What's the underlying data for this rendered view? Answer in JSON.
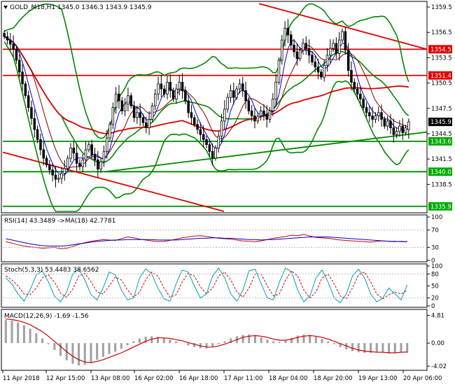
{
  "window": {
    "symbol_line": "GOLD_M18,H1  1345.0 1346.3 1343.9 1345.9",
    "rsi_title": "RSI(14) 43.3489  ->MA(18) 42.7781",
    "stoch_title": "Stoch(5,3,3) 53.4483 38.6562",
    "macd_title": "MACD(12,26,9) -1.69 -1.56"
  },
  "colors": {
    "resistance_line": "#dd0000",
    "support_line": "#008800",
    "bollinger": "#008800",
    "ma_slow": "#dd0000",
    "ma_fast": "#0000cc",
    "ma_mid": "#800000",
    "rsi_line": "#cc0000",
    "rsi_ma": "#0000cc",
    "stoch_main": "#00a0b0",
    "stoch_signal": "#cc0000",
    "macd_hist": "#a0a0a0",
    "macd_signal": "#cc0000",
    "tag_red": "#e00000",
    "tag_green": "#00aa00",
    "tag_black": "#000000"
  },
  "chart_data": [
    {
      "type": "candlestick",
      "panel": "main",
      "title": "GOLD_M18,H1",
      "ohlc_last": {
        "open": 1345.0,
        "high": 1346.3,
        "low": 1343.9,
        "close": 1345.9
      },
      "ylim": [
        1335.3,
        1360.0
      ],
      "y_ticks": [
        "1359.5",
        "1356.5",
        "1353.5",
        "1350.5",
        "1347.5",
        "1344.5",
        "1341.5",
        "1338.5"
      ],
      "price_tags": [
        {
          "label": "1354.5",
          "value": 1354.5,
          "color": "red"
        },
        {
          "label": "1351.4",
          "value": 1351.4,
          "color": "red"
        },
        {
          "label": "1345.9",
          "value": 1345.9,
          "color": "black"
        },
        {
          "label": "1343.6",
          "value": 1343.6,
          "color": "green"
        },
        {
          "label": "1340.0",
          "value": 1340.0,
          "color": "green"
        },
        {
          "label": "1335.9",
          "value": 1335.9,
          "color": "green"
        }
      ],
      "x_labels": [
        "11 Apr 2018",
        "12 Apr 15:00",
        "13 Apr 08:00",
        "16 Apr 02:00",
        "16 Apr 18:00",
        "17 Apr 11:00",
        "18 Apr 04:00",
        "18 Apr 20:00",
        "19 Apr 13:00",
        "20 Apr 06:00"
      ],
      "closes": [
        1356.0,
        1355.6,
        1355.1,
        1354.5,
        1353.2,
        1351.8,
        1350.4,
        1349.0,
        1347.6,
        1346.3,
        1345.0,
        1343.8,
        1342.6,
        1341.6,
        1340.8,
        1340.2,
        1339.6,
        1339.1,
        1339.2,
        1339.8,
        1340.4,
        1341.6,
        1342.8,
        1342.2,
        1341.0,
        1340.6,
        1341.4,
        1342.6,
        1343.2,
        1342.0,
        1341.4,
        1340.3,
        1341.2,
        1342.4,
        1344.0,
        1345.6,
        1347.6,
        1349.2,
        1348.4,
        1347.2,
        1348.0,
        1349.0,
        1347.8,
        1346.4,
        1347.0,
        1346.4,
        1345.8,
        1345.2,
        1346.2,
        1347.8,
        1349.2,
        1350.4,
        1349.8,
        1349.2,
        1350.6,
        1349.6,
        1348.6,
        1349.8,
        1350.6,
        1349.6,
        1348.4,
        1347.0,
        1346.4,
        1345.6,
        1345.0,
        1344.4,
        1343.8,
        1343.2,
        1342.4,
        1341.6,
        1342.8,
        1344.2,
        1346.0,
        1347.4,
        1348.8,
        1349.6,
        1348.8,
        1349.8,
        1350.4,
        1349.6,
        1348.4,
        1347.2,
        1346.6,
        1346.0,
        1346.6,
        1347.2,
        1346.8,
        1346.2,
        1347.2,
        1348.6,
        1350.6,
        1353.2,
        1355.6,
        1357.0,
        1356.2,
        1355.0,
        1354.2,
        1353.4,
        1354.4,
        1355.2,
        1354.6,
        1353.8,
        1353.0,
        1352.4,
        1351.8,
        1351.2,
        1352.6,
        1353.8,
        1354.6,
        1355.2,
        1354.0,
        1355.6,
        1356.6,
        1354.4,
        1352.0,
        1350.6,
        1349.8,
        1349.2,
        1348.6,
        1347.6,
        1347.0,
        1346.6,
        1346.2,
        1346.6,
        1347.0,
        1346.2,
        1345.4,
        1346.0,
        1345.2,
        1344.4,
        1344.8,
        1345.4,
        1344.6,
        1345.2,
        1345.9
      ]
    },
    {
      "type": "line",
      "panel": "rsi",
      "title": "RSI(14)",
      "ylim": [
        0,
        100
      ],
      "y_ticks": [
        "100",
        "70",
        "30",
        "0"
      ],
      "series": [
        {
          "name": "RSI(14)",
          "values": [
            43,
            40,
            36,
            33,
            31,
            30,
            28,
            29,
            30,
            27,
            28,
            32,
            37,
            41,
            44,
            46,
            48,
            47,
            46,
            50,
            54,
            52,
            49,
            47,
            45,
            43,
            44,
            46,
            49,
            52,
            54,
            56,
            57,
            55,
            53,
            51,
            50,
            49,
            47,
            45,
            44,
            43,
            45,
            48,
            51,
            53,
            55,
            58,
            57,
            60,
            56,
            53,
            52,
            51,
            49,
            47,
            46,
            45,
            44,
            43,
            42,
            44,
            45,
            44,
            43,
            44,
            43
          ]
        },
        {
          "name": "MA(18)",
          "values": [
            50,
            47,
            44,
            41,
            38,
            36,
            34,
            33,
            33,
            33,
            34,
            36,
            38,
            40,
            42,
            44,
            45,
            46,
            47,
            47,
            48,
            48,
            48,
            48,
            48,
            47,
            47,
            47,
            47,
            48,
            49,
            50,
            51,
            51,
            52,
            52,
            51,
            51,
            50,
            49,
            48,
            48,
            47,
            48,
            48,
            49,
            50,
            51,
            52,
            53,
            54,
            54,
            54,
            54,
            53,
            52,
            51,
            50,
            49,
            48,
            47,
            46,
            45,
            44,
            44,
            43,
            43
          ]
        }
      ]
    },
    {
      "type": "line",
      "panel": "stochastic",
      "title": "Stoch(5,3,3)",
      "ylim": [
        0,
        100
      ],
      "y_ticks": [
        "100",
        "80",
        "50",
        "20",
        "0"
      ],
      "series": [
        {
          "name": "Main",
          "values": [
            70,
            55,
            30,
            12,
            40,
            78,
            88,
            60,
            25,
            10,
            35,
            80,
            92,
            65,
            28,
            15,
            45,
            85,
            78,
            40,
            15,
            20,
            70,
            93,
            80,
            45,
            18,
            12,
            55,
            90,
            85,
            50,
            20,
            30,
            75,
            95,
            70,
            30,
            12,
            40,
            88,
            92,
            55,
            20,
            15,
            60,
            95,
            85,
            40,
            10,
            25,
            70,
            90,
            60,
            20,
            8,
            30,
            75,
            92,
            70,
            30,
            10,
            20,
            45,
            30,
            15,
            53
          ]
        },
        {
          "name": "Signal",
          "values": [
            75,
            65,
            50,
            30,
            28,
            45,
            70,
            78,
            60,
            32,
            22,
            42,
            75,
            82,
            60,
            35,
            30,
            50,
            72,
            65,
            40,
            22,
            35,
            65,
            85,
            75,
            45,
            22,
            28,
            60,
            82,
            75,
            48,
            30,
            45,
            75,
            85,
            65,
            35,
            22,
            45,
            80,
            80,
            50,
            25,
            30,
            65,
            88,
            75,
            40,
            20,
            35,
            70,
            80,
            55,
            25,
            18,
            45,
            78,
            85,
            60,
            30,
            18,
            28,
            35,
            30,
            39
          ]
        }
      ]
    },
    {
      "type": "bar+line",
      "panel": "macd",
      "title": "MACD(12,26,9)",
      "ylim": [
        -4.5,
        5.5
      ],
      "y_ticks": [
        "4.81",
        "0.00",
        "-4.02"
      ],
      "series": [
        {
          "name": "MACD",
          "values": [
            4.0,
            3.9,
            3.6,
            3.1,
            2.5,
            1.7,
            0.8,
            -0.2,
            -1.2,
            -2.2,
            -3.0,
            -3.6,
            -3.9,
            -3.8,
            -3.4,
            -2.9,
            -2.4,
            -1.9,
            -1.5,
            -1.0,
            -0.4,
            0.3,
            0.8,
            1.1,
            1.2,
            1.1,
            0.9,
            0.6,
            0.3,
            0.0,
            -0.4,
            -0.7,
            -0.9,
            -0.9,
            -0.6,
            -0.2,
            0.3,
            0.8,
            1.2,
            1.4,
            1.5,
            1.3,
            1.0,
            0.6,
            0.3,
            0.2,
            0.4,
            0.9,
            1.3,
            1.5,
            1.4,
            1.1,
            0.7,
            0.3,
            -0.2,
            -0.7,
            -1.1,
            -1.4,
            -1.6,
            -1.7,
            -1.7,
            -1.6,
            -1.7,
            -1.8,
            -1.7,
            -1.7,
            -1.69
          ]
        },
        {
          "name": "Signal",
          "values": [
            4.2,
            4.1,
            3.9,
            3.6,
            3.2,
            2.6,
            2.0,
            1.2,
            0.3,
            -0.6,
            -1.5,
            -2.3,
            -2.9,
            -3.3,
            -3.4,
            -3.2,
            -2.9,
            -2.5,
            -2.1,
            -1.7,
            -1.2,
            -0.7,
            -0.2,
            0.3,
            0.7,
            0.9,
            0.9,
            0.8,
            0.6,
            0.4,
            0.1,
            -0.2,
            -0.5,
            -0.7,
            -0.7,
            -0.5,
            -0.2,
            0.2,
            0.6,
            1.0,
            1.2,
            1.3,
            1.2,
            1.0,
            0.7,
            0.5,
            0.5,
            0.7,
            1.0,
            1.2,
            1.3,
            1.2,
            1.0,
            0.7,
            0.3,
            -0.1,
            -0.5,
            -0.9,
            -1.2,
            -1.4,
            -1.5,
            -1.6,
            -1.6,
            -1.7,
            -1.7,
            -1.6,
            -1.56
          ]
        }
      ]
    }
  ]
}
